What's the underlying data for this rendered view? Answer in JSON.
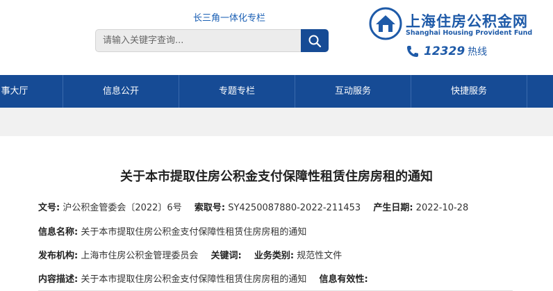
{
  "header": {
    "yrd_link": "长三角一体化专栏",
    "search_placeholder": "请输入关键字查询...",
    "logo_cn": "上海住房公积金网",
    "logo_en": "Shanghai Housing Provident Fund",
    "hotline_number": "12329",
    "hotline_label": "热线",
    "brand_color": "#164b95"
  },
  "nav": {
    "items": [
      {
        "label": "事大厅"
      },
      {
        "label": "信息公开"
      },
      {
        "label": "专题专栏"
      },
      {
        "label": "互动服务"
      },
      {
        "label": "快捷服务"
      }
    ]
  },
  "article": {
    "title": "关于本市提取住房公积金支付保障性租赁住房房租的通知",
    "doc_no_label": "文号:",
    "doc_no_value": "沪公积金管委会〔2022〕6号",
    "index_label": "索取号:",
    "index_value": "SY4250087880-2022-211453",
    "date_label": "产生日期:",
    "date_value": "2022-10-28",
    "info_name_label": "信息名称:",
    "info_name_value": "关于本市提取住房公积金支付保障性租赁住房房租的通知",
    "publisher_label": "发布机构:",
    "publisher_value": "上海市住房公积金管理委员会",
    "keywords_label": "关键词:",
    "keywords_value": "",
    "category_label": "业务类别:",
    "category_value": "规范性文件",
    "desc_label": "内容描述:",
    "desc_value": "关于本市提取住房公积金支付保障性租赁住房房租的通知",
    "validity_label": "信息有效性:",
    "validity_value": ""
  }
}
